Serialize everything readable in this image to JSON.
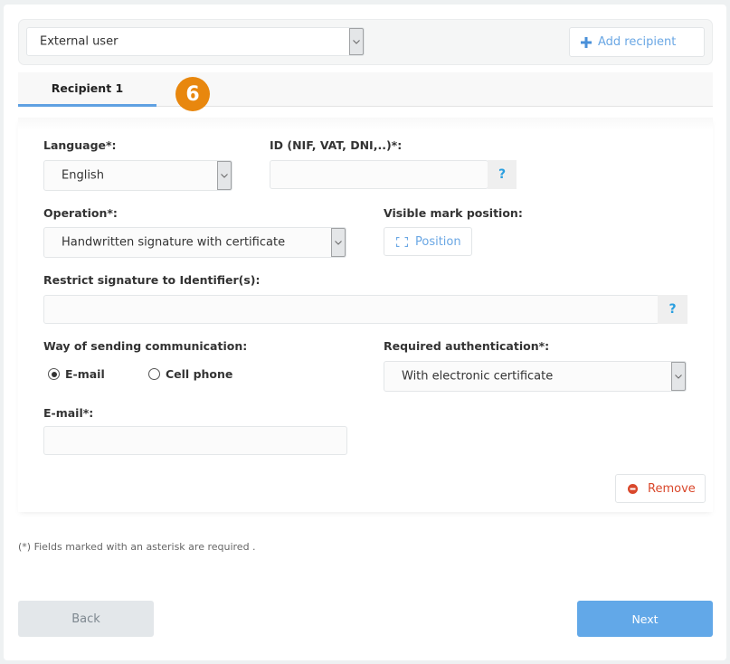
{
  "recipient_type": {
    "selected": "External user"
  },
  "add_recipient": {
    "label": "Add recipient",
    "icon": "plus-icon"
  },
  "tabs": [
    {
      "label": "Recipient 1",
      "active": true
    }
  ],
  "step_badge": "6",
  "form": {
    "language": {
      "label": "Language*:",
      "selected": "English"
    },
    "id_field": {
      "label": "ID (NIF, VAT, DNI,..)*:",
      "value": "",
      "help": "?"
    },
    "operation": {
      "label": "Operation*:",
      "selected": "Handwritten signature with certificate"
    },
    "visible_mark": {
      "label": "Visible mark position:",
      "button": "Position",
      "icon": "frame-corners-icon"
    },
    "restrict": {
      "label": "Restrict signature to Identifier(s):",
      "value": "",
      "help": "?"
    },
    "communication": {
      "label": "Way of sending communication:",
      "options": [
        {
          "label": "E-mail",
          "checked": true
        },
        {
          "label": "Cell phone",
          "checked": false
        }
      ]
    },
    "authentication": {
      "label": "Required authentication*:",
      "selected": "With electronic certificate"
    },
    "email": {
      "label": "E-mail*:",
      "value": ""
    },
    "remove": {
      "label": "Remove",
      "icon": "minus-circle-icon"
    }
  },
  "note": "(*) Fields marked with an asterisk are required .",
  "buttons": {
    "back": "Back",
    "next": "Next"
  },
  "colors": {
    "accent": "#5fa1e2",
    "badge": "#e8870e",
    "danger": "#d9472b",
    "next": "#62a8e8",
    "help": "#2a9fe0"
  }
}
